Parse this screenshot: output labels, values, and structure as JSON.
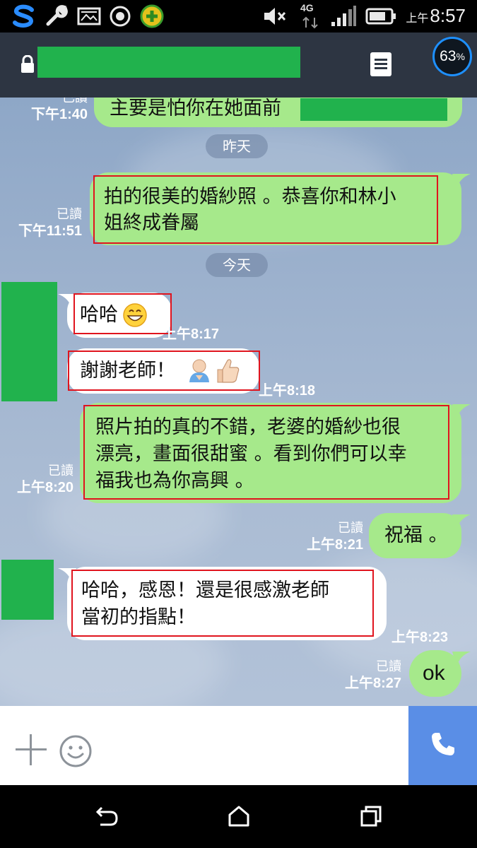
{
  "status_bar": {
    "network_label": "4G",
    "time_prefix": "上午",
    "time": "8:57",
    "icons": [
      "s-app-icon",
      "wrench-icon",
      "image-icon",
      "record-icon",
      "plus-badge-icon",
      "mute-icon",
      "signal-icon",
      "battery-icon"
    ]
  },
  "header": {
    "contact_name_redacted": "",
    "battery_percent": "63",
    "percent_sign": "%"
  },
  "chat": {
    "messages": [
      {
        "id": "m1",
        "side": "me",
        "text": "主要是怕你在她面前",
        "read": "已讀",
        "time": "下午1:40",
        "partial": true
      },
      {
        "id": "d1",
        "type": "date",
        "label": "昨天"
      },
      {
        "id": "m2",
        "side": "me",
        "text": "拍的很美的婚紗照 。恭喜你和林小\n姐終成眷屬",
        "read": "已讀",
        "time": "下午11:51"
      },
      {
        "id": "d2",
        "type": "date",
        "label": "今天"
      },
      {
        "id": "m3",
        "side": "them",
        "text": "哈哈",
        "emoji": "grin-emoji",
        "time": "上午8:17"
      },
      {
        "id": "m4",
        "side": "them",
        "text": "謝謝老師！",
        "emoji": "bow-emoji thumbs-up-emoji",
        "time": "上午8:18"
      },
      {
        "id": "m5",
        "side": "me",
        "text": "照片拍的真的不錯，老婆的婚紗也很\n漂亮，畫面很甜蜜 。看到你們可以幸\n福我也為你高興 。",
        "read": "已讀",
        "time": "上午8:20"
      },
      {
        "id": "m6",
        "side": "me",
        "text": "祝福 。",
        "read": "已讀",
        "time": "上午8:21"
      },
      {
        "id": "m7",
        "side": "them",
        "text": "哈哈，感恩！還是很感激老師\n當初的指點！",
        "time": "上午8:23"
      },
      {
        "id": "m8",
        "side": "me",
        "text": "ok",
        "read": "已讀",
        "time": "上午8:27"
      }
    ]
  },
  "input_bar": {
    "plus_icon": "plus-icon",
    "emoji_icon": "smiley-icon",
    "call_icon": "phone-icon"
  },
  "nav_bar": {
    "icons": [
      "back-icon",
      "home-icon",
      "recents-icon"
    ]
  },
  "colors": {
    "my_bubble": "#a6e98b",
    "their_bubble": "#ffffff",
    "header": "#2d3542",
    "redaction": "#21b24d",
    "highlight_box": "#e0141e",
    "call_button": "#5a8ee6"
  }
}
